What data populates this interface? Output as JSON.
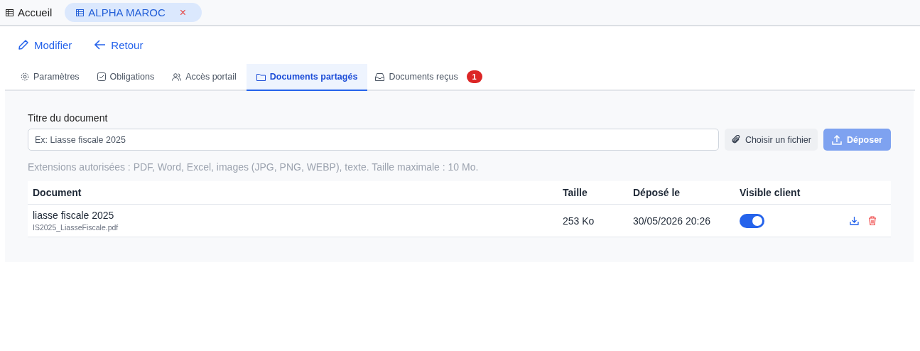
{
  "top_tabs": [
    {
      "label": "Accueil",
      "selected": false
    },
    {
      "label": "ALPHA MAROC",
      "selected": true,
      "close": "×"
    }
  ],
  "actions": [
    {
      "kind": "edit",
      "label": "Modifier"
    },
    {
      "kind": "back",
      "label": "Retour"
    }
  ],
  "tabs": [
    {
      "kind": "gear",
      "label": "Paramètres",
      "selected": false
    },
    {
      "kind": "check",
      "label": "Obligations",
      "selected": false
    },
    {
      "kind": "users",
      "label": "Accès portail",
      "selected": false
    },
    {
      "kind": "folder",
      "label": "Documents partagés",
      "selected": true
    },
    {
      "kind": "inbox",
      "label": "Documents reçus",
      "selected": false,
      "badge": "1"
    }
  ],
  "upload": {
    "label": "Titre du document",
    "placeholder": "Ex: Liasse fiscale 2025",
    "choose_button": "Choisir un fichier",
    "submit_button": "Déposer",
    "submit_disabled": true,
    "hint": "Extensions autorisées : PDF, Word, Excel, images (JPG, PNG, WEBP), texte. Taille maximale : 10 Mo."
  },
  "table": {
    "columns": [
      "Document",
      "Taille",
      "Déposé le",
      "Visible client"
    ],
    "rows": [
      {
        "title": "liasse fiscale 2025",
        "file": "IS2025_LiasseFiscale.pdf",
        "size": "253 Ko",
        "date": "30/05/2026 20:26",
        "visible": true
      }
    ]
  }
}
